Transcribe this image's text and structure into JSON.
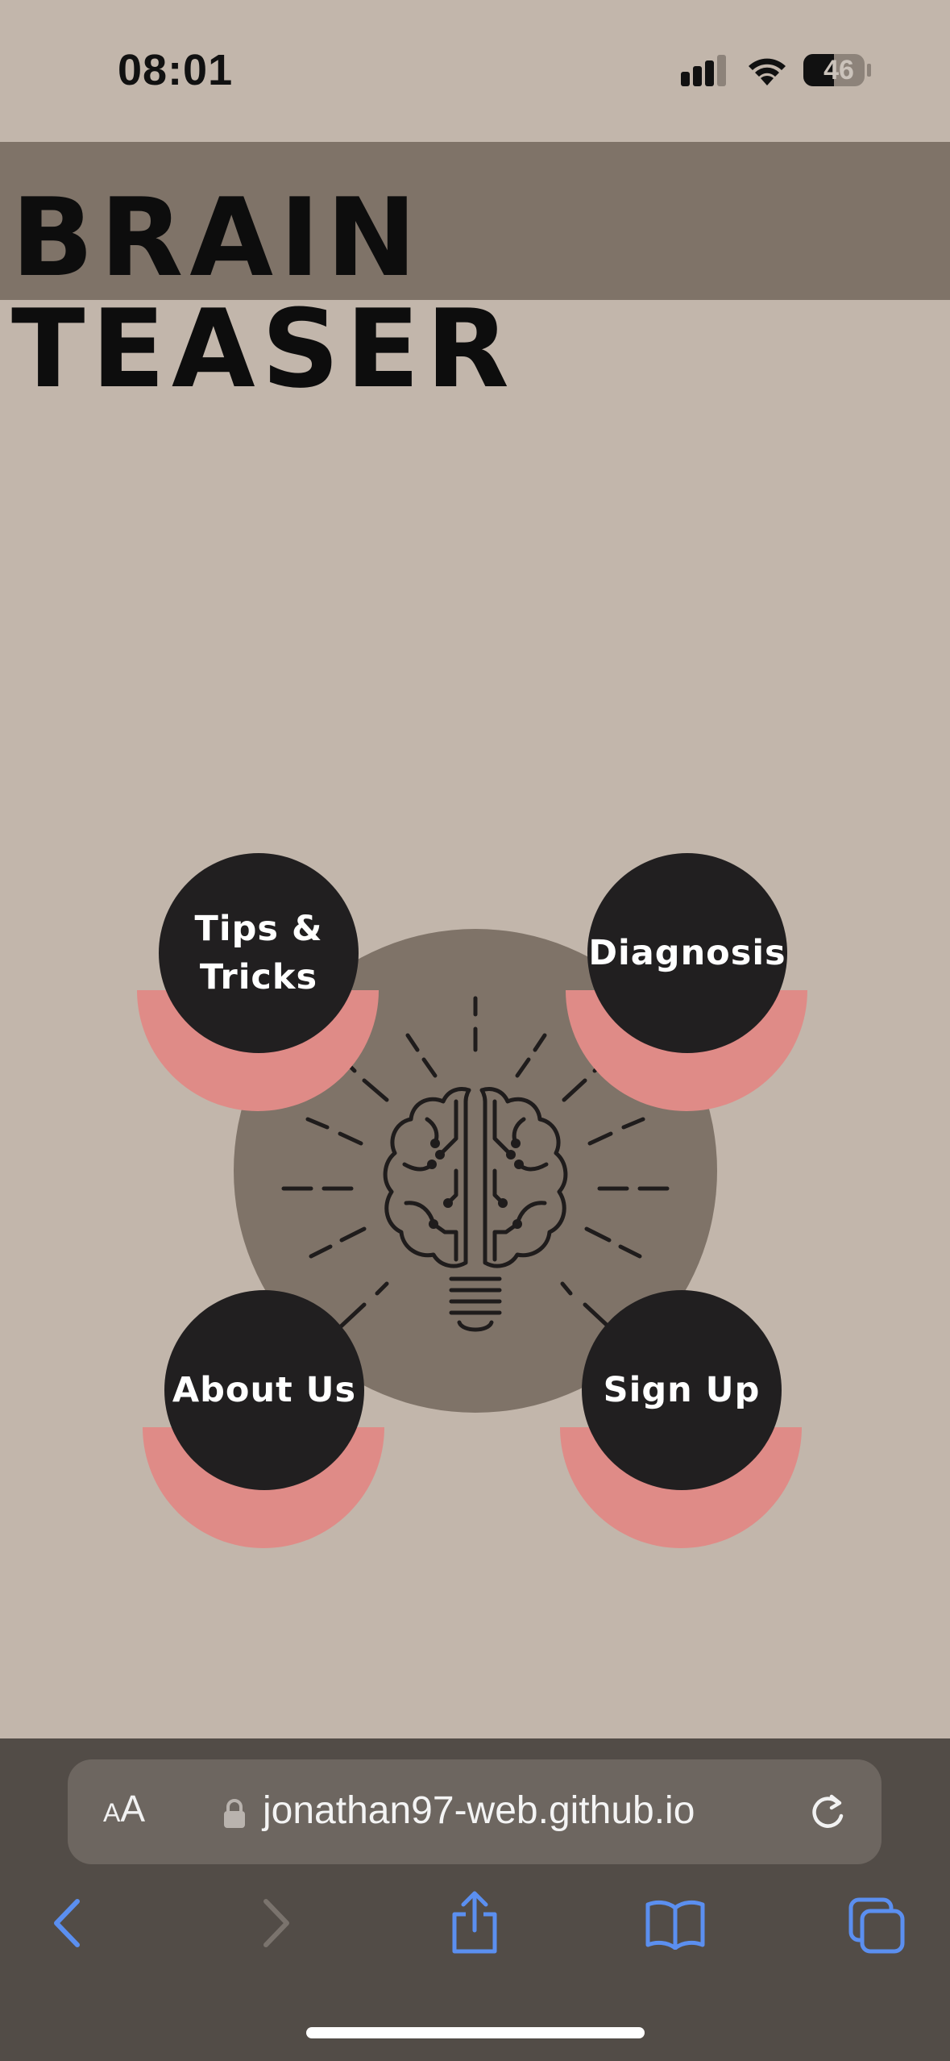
{
  "status_bar": {
    "time": "08:01",
    "battery_percent": "46",
    "icons": [
      "cellular-signal-icon",
      "wifi-icon",
      "battery-icon"
    ]
  },
  "header": {
    "title": "BRAIN\nTEASER"
  },
  "hero": {
    "image": "brain-lightbulb-icon"
  },
  "menu": {
    "items": [
      {
        "label": "Tips &\nTricks"
      },
      {
        "label": "Diagnosis"
      },
      {
        "label": "About Us"
      },
      {
        "label": "Sign Up"
      }
    ]
  },
  "browser": {
    "text_size_button": "AA",
    "url": "jonathan97-web.github.io",
    "toolbar_icons": [
      "back-icon",
      "forward-icon",
      "share-icon",
      "bookmarks-icon",
      "tabs-icon"
    ]
  },
  "colors": {
    "page_background": "#c2b6ab",
    "header_band": "#7f7368",
    "circle_dark": "#211f20",
    "accent_pink": "#df8b87",
    "browser_bar": "#524c47",
    "browser_accent": "#5b8ff0"
  }
}
